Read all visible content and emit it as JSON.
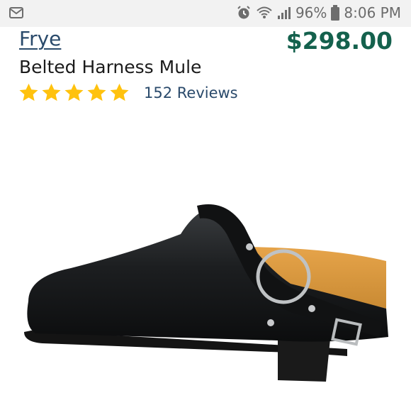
{
  "status_bar": {
    "battery": "96%",
    "time": "8:06 PM",
    "icons": [
      "mail-icon",
      "alarm-icon",
      "wifi-icon",
      "signal-icon",
      "battery-icon"
    ]
  },
  "product": {
    "brand": "Frye",
    "price": "$298.00",
    "name": "Belted Harness Mule",
    "rating": 5,
    "rating_max": 5,
    "reviews_label": "152 Reviews"
  },
  "colors": {
    "star": "#ffc20e",
    "price": "#14614d",
    "link": "#2a4a6b",
    "status_bar_bg": "#f2f2f2"
  }
}
